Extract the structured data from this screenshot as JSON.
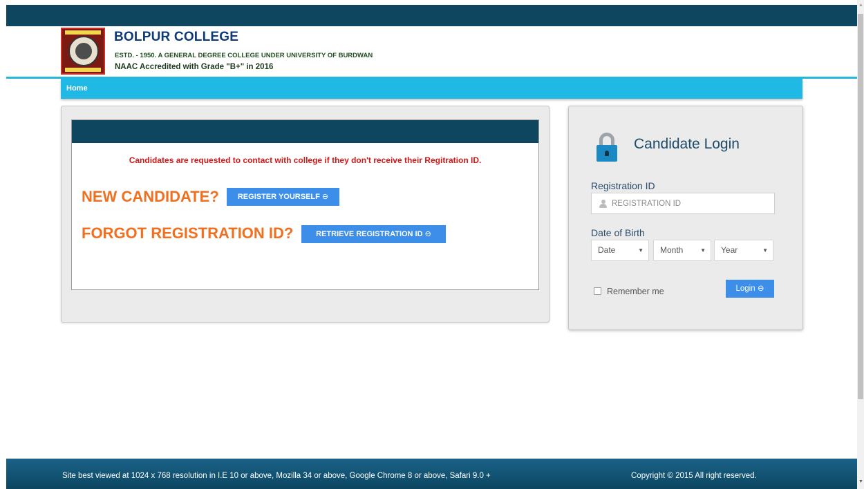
{
  "header": {
    "college_name": "BOLPUR COLLEGE",
    "subtitle": "ESTD. - 1950. A GENERAL DEGREE COLLEGE UNDER UNIVERSITY OF BURDWAN",
    "accreditation": "NAAC Accredited with Grade \"B+\" in 2016",
    "logo_icon": "college-seal-icon"
  },
  "nav": {
    "home_label": "Home"
  },
  "main": {
    "notice": "Candidates are requested to contact with college if they don't receive their Regitration ID.",
    "new_candidate_label": "NEW CANDIDATE?",
    "register_button": "REGISTER YOURSELF",
    "forgot_label": "FORGOT REGISTRATION ID?",
    "retrieve_button": "RETRIEVE REGISTRATION ID",
    "button_arrow": "⊖"
  },
  "login": {
    "title": "Candidate Login",
    "reg_label": "Registration ID",
    "reg_placeholder": "REGISTRATION ID",
    "dob_label": "Date of Birth",
    "date_select": "Date",
    "month_select": "Month",
    "year_select": "Year",
    "remember_label": "Remember me",
    "login_button": "Login",
    "button_arrow": "⊖"
  },
  "footer": {
    "left_text": "Site best viewed at 1024 x 768 resolution in I.E 10 or above, Mozilla 34 or above, Google Chrome 8 or above, Safari 9.0 +",
    "right_text": "Copyright © 2015 All right reserved."
  },
  "colors": {
    "dark_teal": "#0e4660",
    "nav_blue": "#20b8e4",
    "button_blue": "#3c8ee8",
    "orange_heading": "#f07020",
    "notice_red": "#d01818"
  }
}
